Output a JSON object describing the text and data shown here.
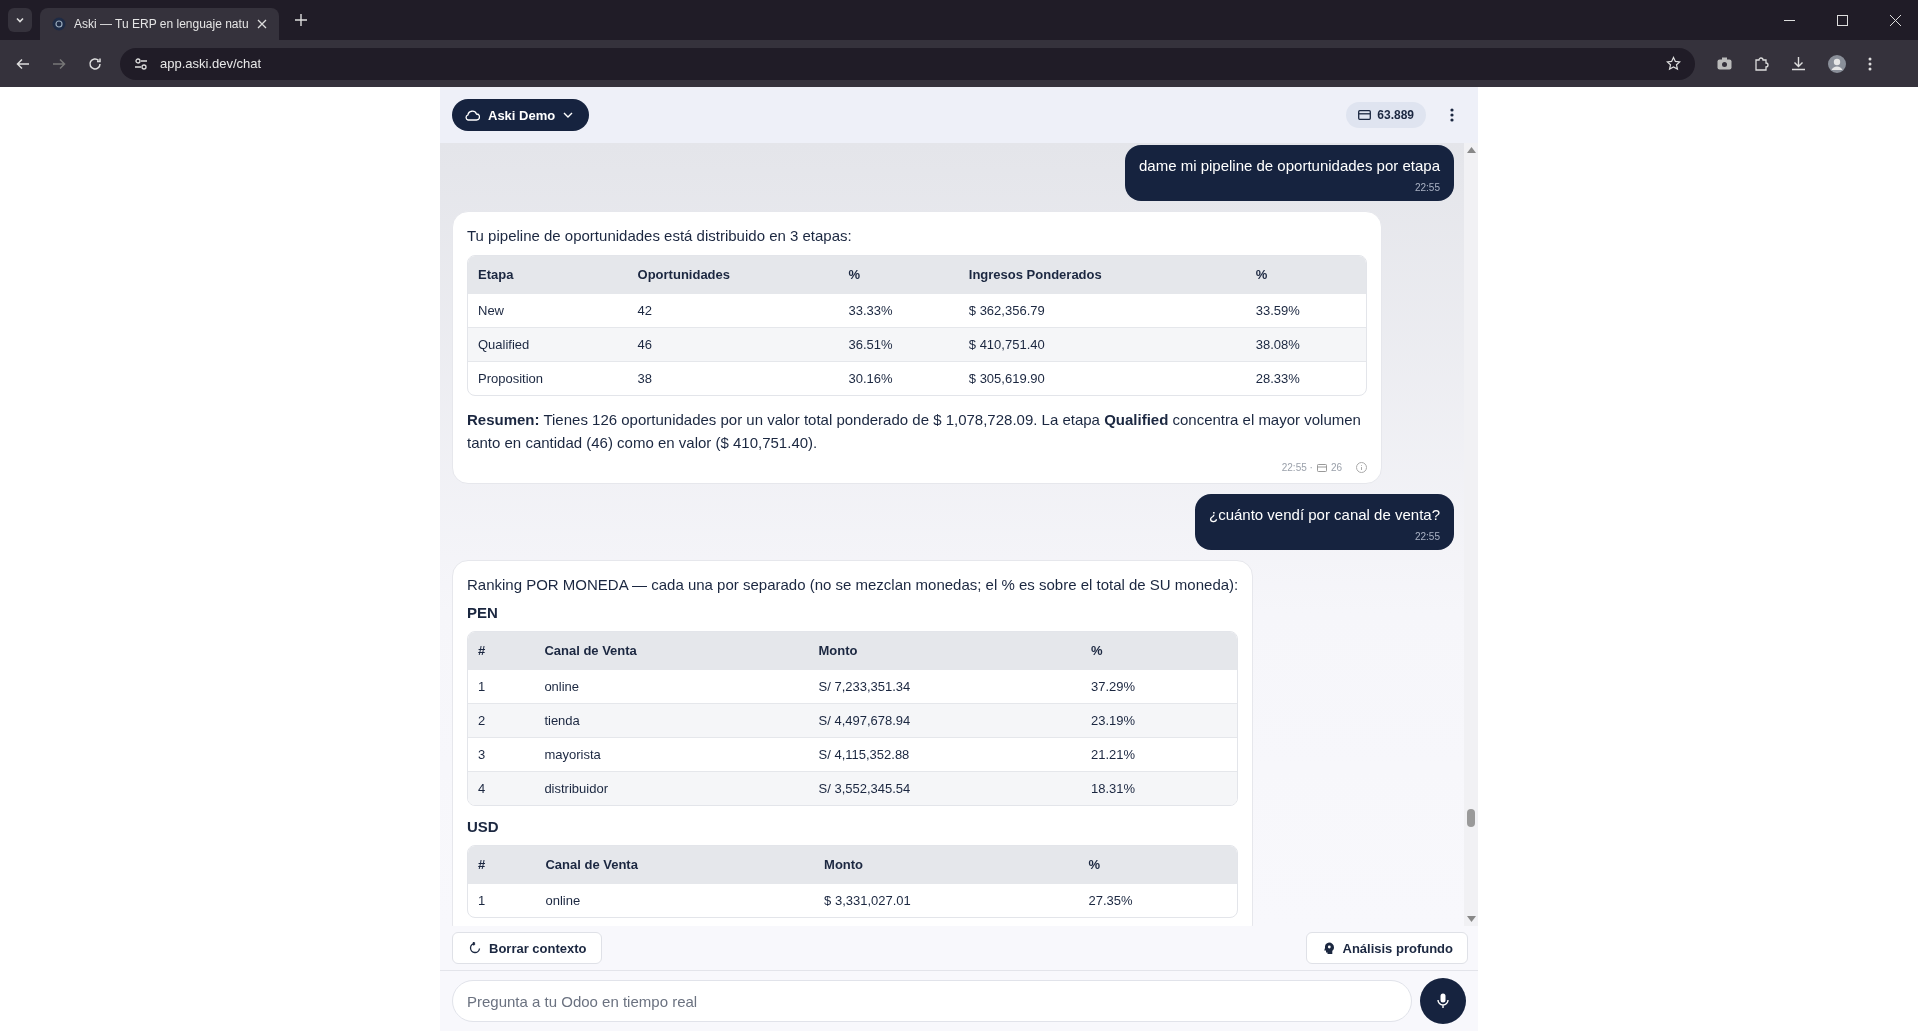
{
  "browser": {
    "tab_title": "Aski — Tu ERP en lenguaje natu",
    "url": "app.aski.dev/chat"
  },
  "header": {
    "workspace": "Aski Demo",
    "credits": "63.889"
  },
  "messages": [
    {
      "kind": "user",
      "text": "dame mi pipeline de oportunidades por etapa",
      "time": "22:55"
    },
    {
      "kind": "assistant",
      "blocks": [
        {
          "kind": "paragraph",
          "text": "Tu pipeline de oportunidades está distribuido en 3 etapas:"
        },
        {
          "kind": "table",
          "columns": [
            "Etapa",
            "Oportunidades",
            "%",
            "Ingresos Ponderados",
            "%"
          ],
          "rows": [
            [
              "New",
              "42",
              "33.33%",
              "$ 362,356.79",
              "33.59%"
            ],
            [
              "Qualified",
              "46",
              "36.51%",
              "$ 410,751.40",
              "38.08%"
            ],
            [
              "Proposition",
              "38",
              "30.16%",
              "$ 305,619.90",
              "28.33%"
            ]
          ]
        },
        {
          "kind": "paragraph",
          "text": "**Resumen:** Tienes 126 oportunidades por un valor total ponderado de $ 1,078,728.09. La etapa **Qualified** concentra el mayor volumen tanto en cantidad (46) como en valor ($ 410,751.40)."
        }
      ],
      "time": "22:55 ·",
      "credits": "26"
    },
    {
      "kind": "user",
      "text": "¿cuánto vendí por canal de venta?",
      "time": "22:55"
    },
    {
      "kind": "assistant",
      "blocks": [
        {
          "kind": "paragraph",
          "text": "Ranking POR MONEDA — cada una por separado (no se mezclan monedas; el % es sobre el total de SU moneda):"
        },
        {
          "kind": "heading",
          "text": "PEN"
        },
        {
          "kind": "table",
          "columns": [
            "#",
            "Canal de Venta",
            "Monto",
            "%"
          ],
          "rows": [
            [
              "1",
              "online",
              "S/ 7,233,351.34",
              "37.29%"
            ],
            [
              "2",
              "tienda",
              "S/ 4,497,678.94",
              "23.19%"
            ],
            [
              "3",
              "mayorista",
              "S/ 4,115,352.88",
              "21.21%"
            ],
            [
              "4",
              "distribuidor",
              "S/ 3,552,345.54",
              "18.31%"
            ]
          ]
        },
        {
          "kind": "heading",
          "text": "USD"
        },
        {
          "kind": "table",
          "columns": [
            "#",
            "Canal de Venta",
            "Monto",
            "%"
          ],
          "rows": [
            [
              "1",
              "online",
              "$ 3,331,027.01",
              "27.35%"
            ]
          ]
        }
      ]
    }
  ],
  "footer": {
    "clear_button": "Borrar contexto",
    "deep_button": "Análisis profundo",
    "input_placeholder": "Pregunta a tu Odoo en tiempo real"
  }
}
